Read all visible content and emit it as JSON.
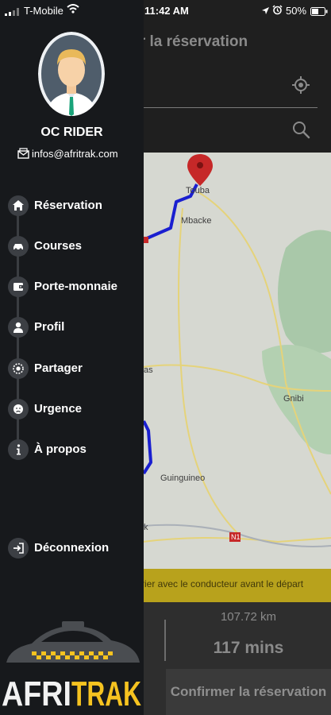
{
  "status_bar": {
    "carrier": "T-Mobile",
    "time": "11:42 AM",
    "battery": "50%"
  },
  "app": {
    "title": "ier la réservation",
    "notice": "rier avec le conducteur avant le départ",
    "distance": "107.72 km",
    "duration": "117 mins",
    "confirm_label": "Confirmer la réservation",
    "route_color": "#1a1fd0",
    "pin_color": "#c62828"
  },
  "map": {
    "labels": {
      "touba": "Touba",
      "mbacke": "Mbacke",
      "gnibi": "Gnibi",
      "guinguineo": "Guinguineo",
      "as": "as",
      "k": "k",
      "n1": "N1"
    }
  },
  "drawer": {
    "user_name": "OC RIDER",
    "email": "infos@afritrak.com",
    "items": [
      {
        "label": "Réservation",
        "icon": "home-icon"
      },
      {
        "label": "Courses",
        "icon": "car-icon"
      },
      {
        "label": "Porte-monnaie",
        "icon": "wallet-icon"
      },
      {
        "label": "Profil",
        "icon": "person-icon"
      },
      {
        "label": "Partager",
        "icon": "share-icon"
      },
      {
        "label": "Urgence",
        "icon": "emergency-icon"
      },
      {
        "label": "À propos",
        "icon": "info-icon"
      },
      {
        "label": "Déconnexion",
        "icon": "logout-icon"
      }
    ],
    "logo_text": "AFRITRAK",
    "logo_colors": {
      "afri": "#f2f2f2",
      "trak": "#f6c320"
    }
  }
}
